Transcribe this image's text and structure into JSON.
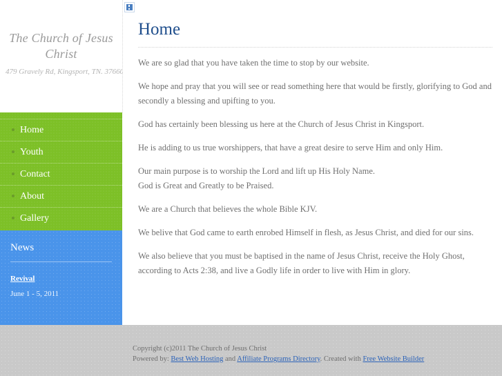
{
  "site": {
    "title": "The Church of Jesus Christ",
    "address": "479 Gravely Rd, Kingsport, TN. 37660",
    "colors": {
      "nav_green": "#7dc027",
      "news_blue": "#4a94ea",
      "heading_navy": "#1f4e8c",
      "footer_gray": "#c9c9c9",
      "link_blue": "#2b62b8"
    }
  },
  "nav": {
    "items": [
      {
        "label": "Home"
      },
      {
        "label": "Youth"
      },
      {
        "label": "Contact"
      },
      {
        "label": "About"
      },
      {
        "label": "Gallery"
      }
    ]
  },
  "news": {
    "title": "News",
    "item_link": "Revival",
    "item_date": "June 1 - 5, 2011"
  },
  "content": {
    "broken_image_alt": "broken-image",
    "page_title": "Home",
    "paragraphs": [
      {
        "text": "We are so glad that you have taken the time to stop by our website."
      },
      {
        "text": "We hope and pray that you will see or read something here that would be firstly, glorifying to God and secondly a blessing and upifting to you."
      },
      {
        "text": "God has certainly been blessing us here at the Church of Jesus Christ in Kingsport."
      },
      {
        "text": "He is adding to us true worshippers, that have a great desire to serve Him and only Him."
      },
      {
        "text": "Our main purpose is to worship the Lord and lift up His Holy Name.",
        "subline": "God is Great and Greatly to be Praised."
      },
      {
        "text": "We are a Church that believes the whole Bible KJV."
      },
      {
        "text": "We belive that God came to earth enrobed Himself in flesh, as Jesus Christ, and died for our sins."
      },
      {
        "text": "We also believe that you must be baptised in the name of Jesus Christ, receive the Holy Ghost, according to Acts 2:38, and live a Godly life in order to live with Him in glory."
      }
    ]
  },
  "footer": {
    "copyright": "Copyright (c)2011 The Church of Jesus Christ",
    "powered_by_prefix": "Powered by: ",
    "link_hosting": "Best Web Hosting",
    "and_text": " and ",
    "link_directory": "Affiliate Programs Directory",
    "created_with_text": ". Created with ",
    "link_builder": "Free Website Builder"
  }
}
